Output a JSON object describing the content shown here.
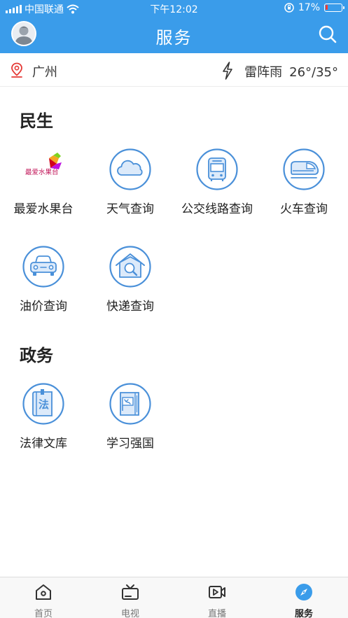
{
  "status_bar": {
    "carrier": "中国联通",
    "time": "下午12:02",
    "battery": "17%",
    "battery_level": 0.17,
    "icons": [
      "signal-icon",
      "wifi-icon",
      "orientation-lock-icon",
      "battery-icon"
    ]
  },
  "header": {
    "title": "服务",
    "avatar_icon": "avatar-icon",
    "search_icon": "search-icon"
  },
  "location": {
    "city": "广州",
    "weather": "雷阵雨",
    "temperature": "26°/35°",
    "icons": [
      "location-pin-icon",
      "thunder-icon"
    ]
  },
  "sections": [
    {
      "title": "民生",
      "items": [
        {
          "label": "最爱水果台",
          "icon": "fruit-station-logo",
          "logo_text": "最爱水果台"
        },
        {
          "label": "天气查询",
          "icon": "cloud-icon"
        },
        {
          "label": "公交线路查询",
          "icon": "bus-icon"
        },
        {
          "label": "火车查询",
          "icon": "train-icon"
        },
        {
          "label": "油价查询",
          "icon": "car-icon"
        },
        {
          "label": "快递查询",
          "icon": "house-search-icon"
        }
      ]
    },
    {
      "title": "政务",
      "items": [
        {
          "label": "法律文库",
          "icon": "law-book-icon",
          "icon_text": "法"
        },
        {
          "label": "学习强国",
          "icon": "flag-book-icon"
        }
      ]
    }
  ],
  "tabbar": {
    "active": "服务",
    "tabs": [
      {
        "label": "首页",
        "icon": "home-icon"
      },
      {
        "label": "电视",
        "icon": "tv-icon"
      },
      {
        "label": "直播",
        "icon": "video-camera-icon"
      },
      {
        "label": "服务",
        "icon": "compass-icon"
      }
    ]
  },
  "colors": {
    "brand_blue": "#3a9cea",
    "icon_blue": "#4a90d9",
    "icon_fill": "#dceafa",
    "location_red": "#e53935",
    "battery_red": "#ff3b30"
  }
}
